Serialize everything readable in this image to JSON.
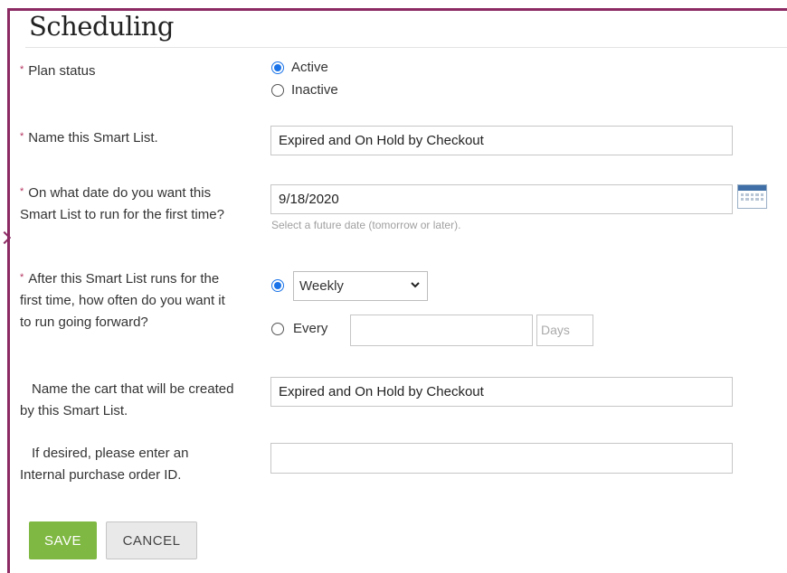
{
  "header": {
    "title": "Scheduling"
  },
  "colors": {
    "frame": "#8b2a63",
    "required": "#b4325e",
    "radio_selected": "#1a73e8",
    "save_button": "#7fb842"
  },
  "form": {
    "plan_status": {
      "label": "Plan status",
      "required": true,
      "options": [
        {
          "label": "Active",
          "selected": true
        },
        {
          "label": "Inactive",
          "selected": false
        }
      ]
    },
    "name": {
      "label": "Name this Smart List.",
      "required": true,
      "value": "Expired and On Hold by Checkout"
    },
    "date": {
      "label": "On what date do you want this Smart List to run for the first time?",
      "required": true,
      "value": "9/18/2020",
      "hint": "Select a future date (tomorrow or later).",
      "icon": "calendar-icon"
    },
    "frequency": {
      "label": "After this Smart List runs for the first time, how often do you want it to run going forward?",
      "required": true,
      "preset_selected": true,
      "preset_value": "Weekly",
      "every_label": "Every",
      "every_value": "",
      "unit_placeholder": "Days"
    },
    "cart_name": {
      "label": "Name the cart that will be created by this Smart List.",
      "required": false,
      "value": "Expired and On Hold by Checkout"
    },
    "po": {
      "label": "If desired, please enter an Internal purchase order ID.",
      "required": false,
      "value": ""
    }
  },
  "buttons": {
    "save": "SAVE",
    "cancel": "CANCEL"
  }
}
